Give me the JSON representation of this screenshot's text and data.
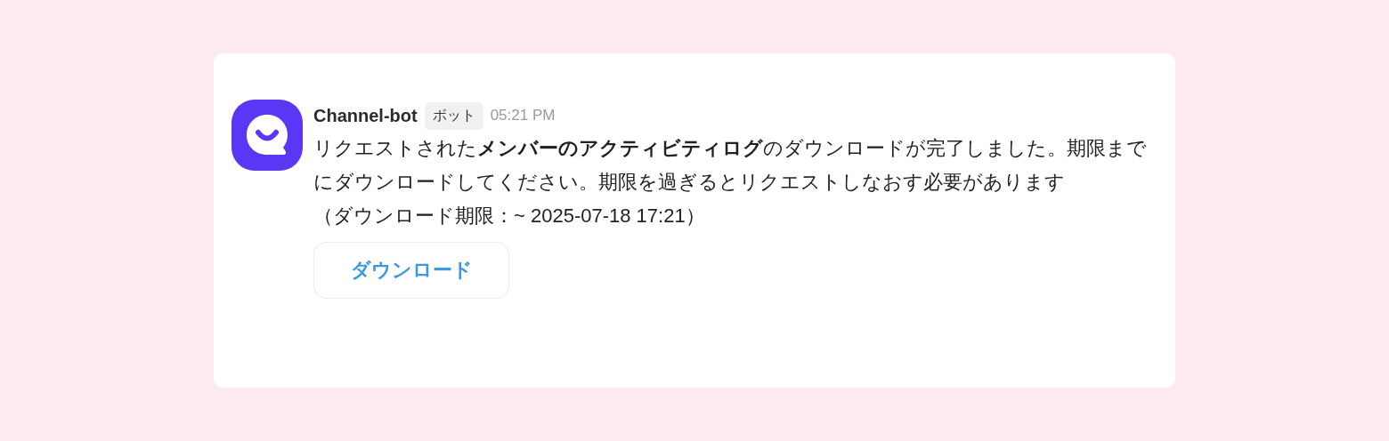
{
  "message": {
    "sender": "Channel-bot",
    "badge": "ボット",
    "time": "05:21 PM",
    "body": "リクエストされた**メンバーのアクティビティログ**のダウンロードが完了しました。期限までにダウンロードしてください。期限を過ぎるとリクエストしなおす必要があります",
    "deadline": "（ダウンロード期限：~ 2025-07-18 17:21）",
    "button": "ダウンロード"
  }
}
